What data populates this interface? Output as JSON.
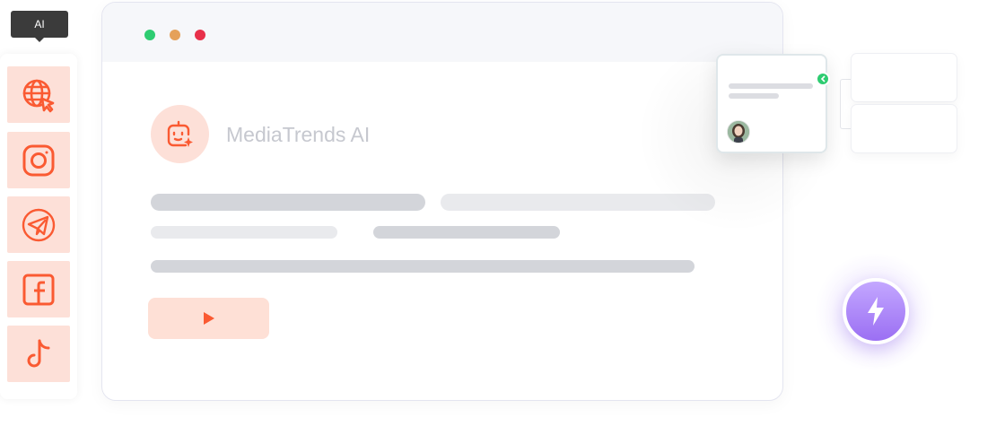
{
  "tooltip": {
    "label": "AI"
  },
  "sidebar": {
    "items": [
      {
        "name": "globe",
        "icon": "globe-cursor-icon"
      },
      {
        "name": "instagram",
        "icon": "instagram-icon"
      },
      {
        "name": "telegram",
        "icon": "telegram-icon"
      },
      {
        "name": "facebook",
        "icon": "facebook-icon"
      },
      {
        "name": "tiktok",
        "icon": "tiktok-icon"
      }
    ]
  },
  "browser": {
    "window_dots": [
      "#2ecc71",
      "#e5a15a",
      "#e8304a"
    ],
    "app_name": "MediaTrends AI",
    "logo_icon": "ai-bot-icon",
    "play_icon": "play-icon"
  },
  "float_card": {
    "avatar_icon": "user-avatar",
    "connector_icon": "chevron-left-icon"
  },
  "action": {
    "icon": "lightning-bolt-icon"
  },
  "colors": {
    "accent": "#fa5a32",
    "accent_light": "#fde0d8",
    "bolt": "#a47dff",
    "success": "#2ecc71"
  }
}
